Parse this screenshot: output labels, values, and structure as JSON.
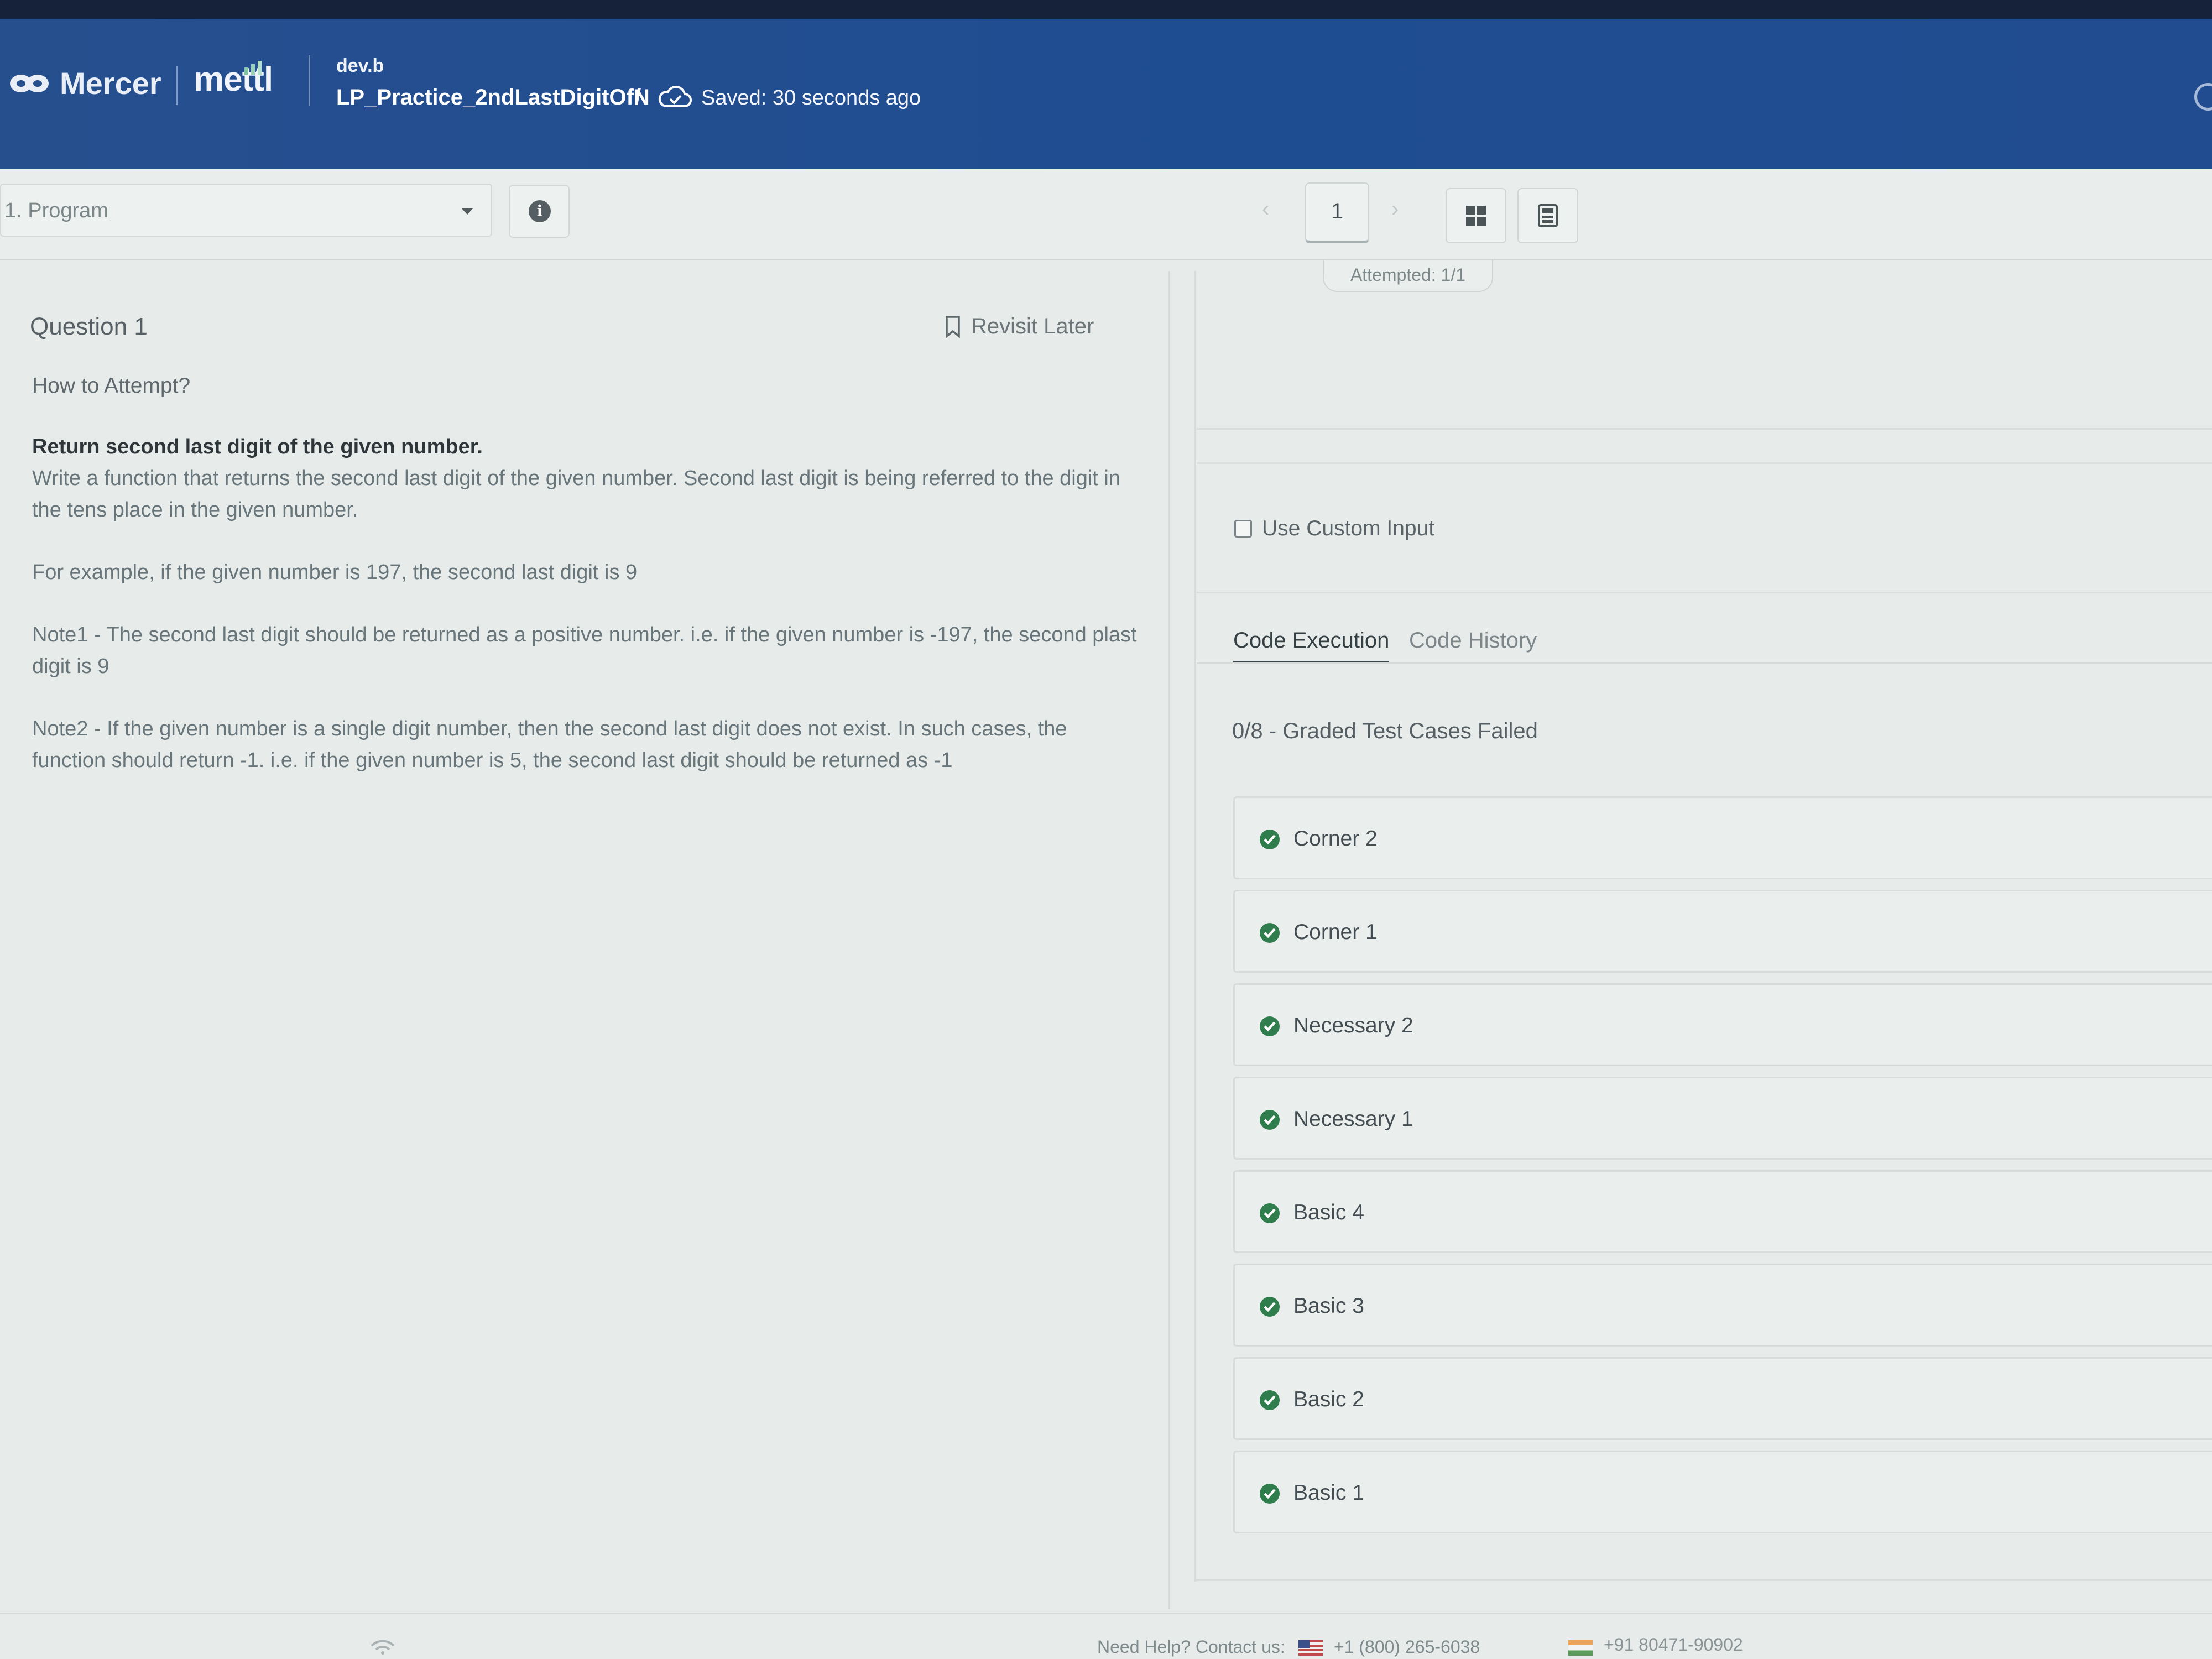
{
  "header": {
    "brand_mercer": "Mercer",
    "brand_mettl": "mettl",
    "org": "dev.b",
    "test_title": "LP_Practice_2ndLastDigitOfN",
    "separator": "/",
    "saved_status": "Saved: 30 seconds ago",
    "colors": {
      "bar": "#214d90",
      "top_strip": "#16213a"
    }
  },
  "toolbar": {
    "section_select": "1. Program",
    "info_icon": "info-icon",
    "page_prev": "‹",
    "page_current": "1",
    "page_next": "›",
    "grid_icon": "grid-icon",
    "calculator_icon": "calculator-icon",
    "attempted": "Attempted: 1/1"
  },
  "question": {
    "title": "Question 1",
    "revisit_label": "Revisit Later",
    "how_to": "How to Attempt?",
    "heading": "Return second last digit of the given number.",
    "paragraph1": "Write a function that returns the second last digit of the given number. Second last digit is being referred to the digit in the tens place in the given number.",
    "paragraph2": "For example, if the given number is 197, the second last digit is 9",
    "paragraph3": "Note1 - The second last digit should be returned as a positive number. i.e. if the given number is -197, the second plast digit is 9",
    "paragraph4": "Note2 - If the given number is a single digit number, then the second last digit does not exist. In such cases, the function should return -1. i.e. if the given number is 5, the second last digit should be returned as -1"
  },
  "execution": {
    "custom_input_label": "Use Custom Input",
    "custom_input_checked": false,
    "tabs": [
      {
        "label": "Code Execution",
        "active": true
      },
      {
        "label": "Code History",
        "active": false
      }
    ],
    "graded_summary": "0/8 - Graded Test Cases Failed",
    "test_cases": [
      {
        "name": "Corner 2",
        "status": "pass"
      },
      {
        "name": "Corner 1",
        "status": "pass"
      },
      {
        "name": "Necessary 2",
        "status": "pass"
      },
      {
        "name": "Necessary 1",
        "status": "pass"
      },
      {
        "name": "Basic 4",
        "status": "pass"
      },
      {
        "name": "Basic 3",
        "status": "pass"
      },
      {
        "name": "Basic 2",
        "status": "pass"
      },
      {
        "name": "Basic 1",
        "status": "pass"
      }
    ],
    "pass_color": "#2f7d4c"
  },
  "footer": {
    "help_label": "Need Help? Contact us:",
    "phone_us": "+1 (800) 265-6038",
    "phone_in": "+91 80471-90902"
  }
}
